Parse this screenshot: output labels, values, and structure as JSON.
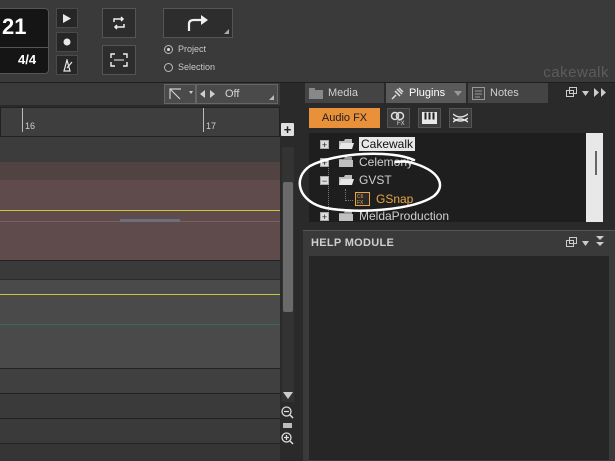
{
  "transport": {
    "bar_number": "21",
    "time_signature": "4/4",
    "export_options": [
      "Project",
      "Selection"
    ],
    "export_selected": "Project"
  },
  "brand": "cakewalk",
  "track_view": {
    "snap_value": "Off",
    "ruler_ticks": [
      "16",
      "17"
    ]
  },
  "browser": {
    "tabs": [
      {
        "label": "Media",
        "active": false
      },
      {
        "label": "Plugins",
        "active": true
      },
      {
        "label": "Notes",
        "active": false
      }
    ],
    "plugin_category": "Audio FX",
    "tree": [
      {
        "label": "Cakewalk",
        "expander": "+",
        "selected": true,
        "type": "folder"
      },
      {
        "label": "Celemony",
        "expander": "+",
        "selected": false,
        "type": "folder"
      },
      {
        "label": "GVST",
        "expander": "−",
        "selected": false,
        "type": "folder"
      },
      {
        "label": "GSnap",
        "expander": "",
        "selected": false,
        "type": "plugin"
      },
      {
        "label": "MeldaProduction",
        "expander": "+",
        "selected": false,
        "type": "folder"
      }
    ],
    "annotation_color": "#ffffff",
    "accent_color": "#e8913a"
  },
  "help_module": {
    "title": "HELP MODULE"
  }
}
